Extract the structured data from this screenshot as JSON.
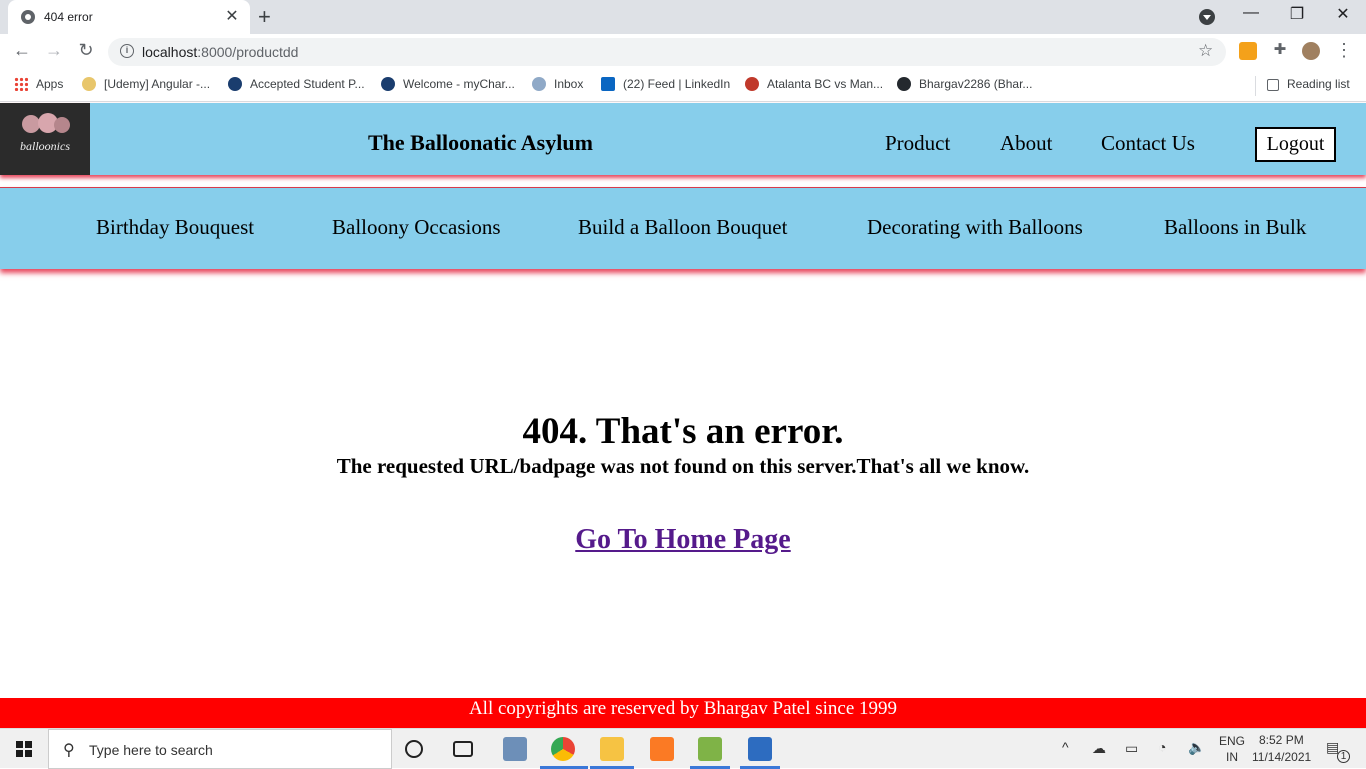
{
  "browser": {
    "tab_title": "404 error",
    "tab_close": "✕",
    "new_tab": "+",
    "url_host": "localhost",
    "url_rest": ":8000/productdd",
    "controls": {
      "minimize": "—",
      "restore": "❐",
      "close": "✕"
    }
  },
  "bookmarks": [
    {
      "label": "Apps"
    },
    {
      "label": "[Udemy] Angular -..."
    },
    {
      "label": "Accepted Student P..."
    },
    {
      "label": "Welcome - myChar..."
    },
    {
      "label": "Inbox"
    },
    {
      "label": "(22) Feed | LinkedIn"
    },
    {
      "label": "Atalanta BC vs Man..."
    },
    {
      "label": "Bhargav2286 (Bhar..."
    }
  ],
  "reading_list": "Reading list",
  "site": {
    "logo_text": "balloonics",
    "title": "The Balloonatic Asylum",
    "nav": [
      "Product",
      "About",
      "Contact Us"
    ],
    "logout": "Logout",
    "categories": [
      "Birthday Bouquest",
      "Balloony Occasions",
      "Build a Balloon Bouquet",
      "Decorating with Balloons",
      "Balloons in Bulk"
    ],
    "error_title": "404. That's an error.",
    "error_message": "The requested URL/badpage was not found on this server.That's all we know.",
    "home_link": "Go To Home Page",
    "footer": "All copyrights are reserved by Bhargav Patel since 1999"
  },
  "colors": {
    "header_bg": "#87ceeb",
    "footer_bg": "#ff0000",
    "accent_shadow": "#e8495f",
    "link": "#551a8b"
  },
  "taskbar": {
    "search_placeholder": "Type here to search",
    "lang": "ENG",
    "region": "IN",
    "time": "8:52 PM",
    "date": "11/14/2021",
    "notifications": "1"
  }
}
